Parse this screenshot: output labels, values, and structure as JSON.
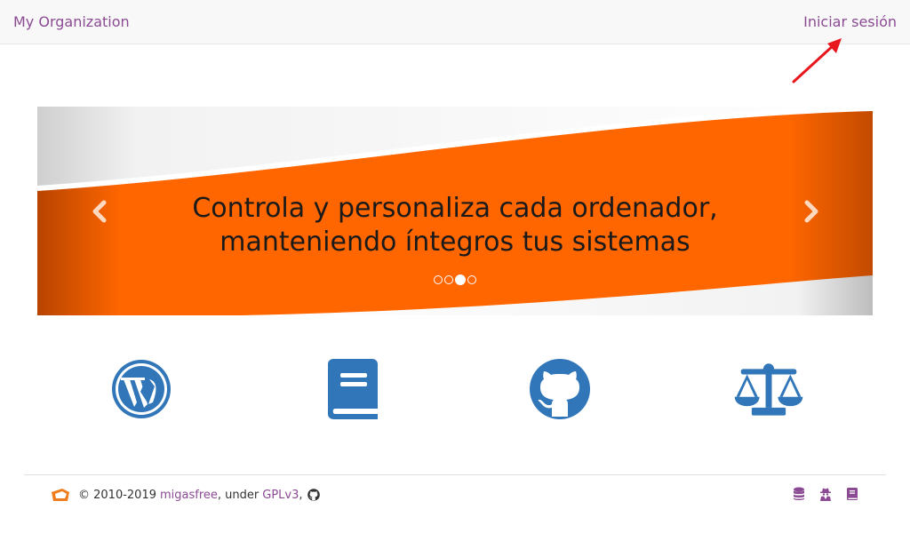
{
  "navbar": {
    "brand": "My Organization",
    "login_label": "Iniciar sesión"
  },
  "carousel": {
    "caption_line1": "Controla y personaliza cada ordenador,",
    "caption_line2": "manteniendo íntegros tus sistemas",
    "slide_count": 4,
    "active_index": 2,
    "colors": {
      "accent": "#ff6600",
      "dark_edge": "#c24a00",
      "swoosh": "#e8e8e8"
    }
  },
  "links": [
    {
      "icon": "wordpress-icon"
    },
    {
      "icon": "book-icon"
    },
    {
      "icon": "github-icon"
    },
    {
      "icon": "balance-scale-icon"
    }
  ],
  "footer": {
    "copyright": "© 2010-2019",
    "project_link": "migasfree",
    "under_text": ", under",
    "license_link": "GPLv3",
    "comma": ",",
    "icons": [
      "database-icon",
      "user-secret-icon",
      "book-icon"
    ]
  },
  "colors": {
    "link": "#8b4a93",
    "icon_blue": "#3176b8",
    "annotation_red": "#e8161d"
  }
}
